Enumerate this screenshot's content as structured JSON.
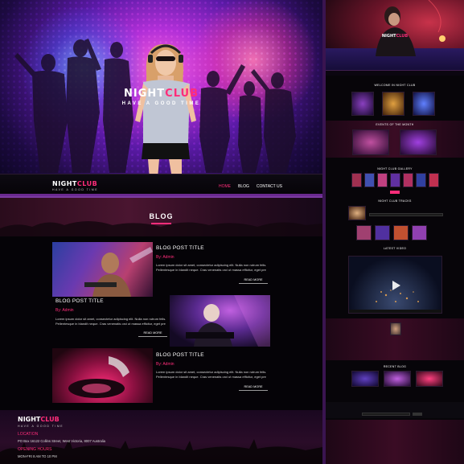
{
  "hero": {
    "title_a": "NIGHT",
    "title_b": "CLUB",
    "tagline": "HAVE A GOOD TIME"
  },
  "navbar": {
    "brand_a": "NIGHT",
    "brand_b": "CLUB",
    "brand_tag": "HAVE A GOOD TIME",
    "links": [
      "HOME",
      "BLOG",
      "CONTACT US"
    ],
    "active": "HOME"
  },
  "blog": {
    "heading": "BLOG",
    "posts": [
      {
        "title": "BLOG POST TITLE",
        "author": "By: Admin",
        "text": "Lorem ipsum dolor sit amet, consectetur adipiscing elit. Nulla non rutrum felis. Pellentesque in blandit neque. Cras venenatis orci ut massa efficitur, eget pre",
        "read_more": "READ MORE"
      },
      {
        "title": "BLOG POST TITLE",
        "author": "By: Admin",
        "text": "Lorem ipsum dolor sit amet, consectetur adipiscing elit. Nulla non rutrum felis. Pellentesque in blandit neque. Cras venenatis orci ut massa efficitur, eget pre",
        "read_more": "READ MORE"
      },
      {
        "title": "BLOG POST TITLE",
        "author": "By: Admin",
        "text": "Lorem ipsum dolor sit amet, consectetur adipiscing elit. Nulla non rutrum felis. Pellentesque in blandit neque. Cras venenatis orci ut massa efficitur, eget pre",
        "read_more": "READ MORE"
      }
    ]
  },
  "footer": {
    "brand_a": "NIGHT",
    "brand_b": "CLUB",
    "brand_tag": "HAVE A GOOD TIME",
    "location_label": "LOCATION",
    "address": "PO Box 16122 Collins Street, West Victoria, 8007 Australia",
    "hours_label": "OPENING HOURS",
    "hours": "MON-FRI 8 AM TO 10 PM"
  },
  "preview": {
    "hero_a": "NIGHT",
    "hero_b": "CLUB",
    "welcome": "WELCOME IN NIGHT CLUB",
    "events": "EVENTS OF THE MONTH",
    "gallery": "NIGHT CLUB GALLERY",
    "tracks": "NIGHT CLUB TRACKS",
    "video": "LATEST VIDEO",
    "blog": "RECENT BLOG"
  },
  "colors": {
    "accent": "#ff2d7a",
    "bg": "#050307",
    "separator": "#7a3aa0"
  }
}
